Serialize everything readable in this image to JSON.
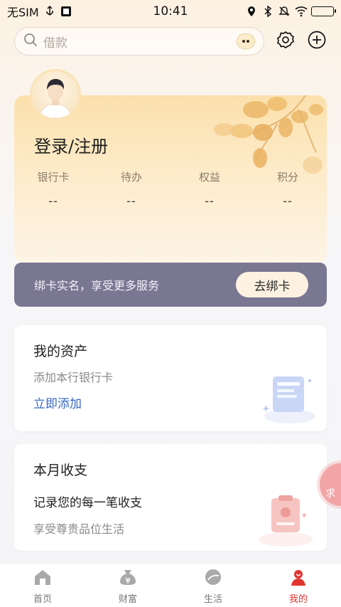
{
  "status_bar": {
    "carrier": "无SIM",
    "time": "10:41"
  },
  "header": {
    "search_placeholder": "借款",
    "icons": [
      "search-icon",
      "mascot-icon",
      "settings-icon",
      "add-icon"
    ]
  },
  "profile": {
    "login_label": "登录/注册",
    "stats": [
      {
        "label": "银行卡",
        "value": "--"
      },
      {
        "label": "待办",
        "value": "--"
      },
      {
        "label": "权益",
        "value": "--"
      },
      {
        "label": "积分",
        "value": "--"
      }
    ]
  },
  "bind_banner": {
    "text": "绑卡实名，享受更多服务",
    "button_label": "去绑卡"
  },
  "assets_card": {
    "title": "我的资产",
    "subtitle": "添加本行银行卡",
    "link": "立即添加"
  },
  "budget_card": {
    "title": "本月收支",
    "line1": "记录您的每一笔收支",
    "line2": "享受尊贵品位生活"
  },
  "side_help": {
    "text": "求"
  },
  "tabbar": {
    "items": [
      {
        "label": "首页",
        "icon": "home-icon"
      },
      {
        "label": "财富",
        "icon": "wealth-icon"
      },
      {
        "label": "生活",
        "icon": "life-icon"
      },
      {
        "label": "我的",
        "icon": "profile-icon"
      }
    ],
    "active_index": 3
  },
  "colors": {
    "accent_red": "#e2342f",
    "link_blue": "#3a68c7",
    "banner_bg": "#7a7792"
  }
}
